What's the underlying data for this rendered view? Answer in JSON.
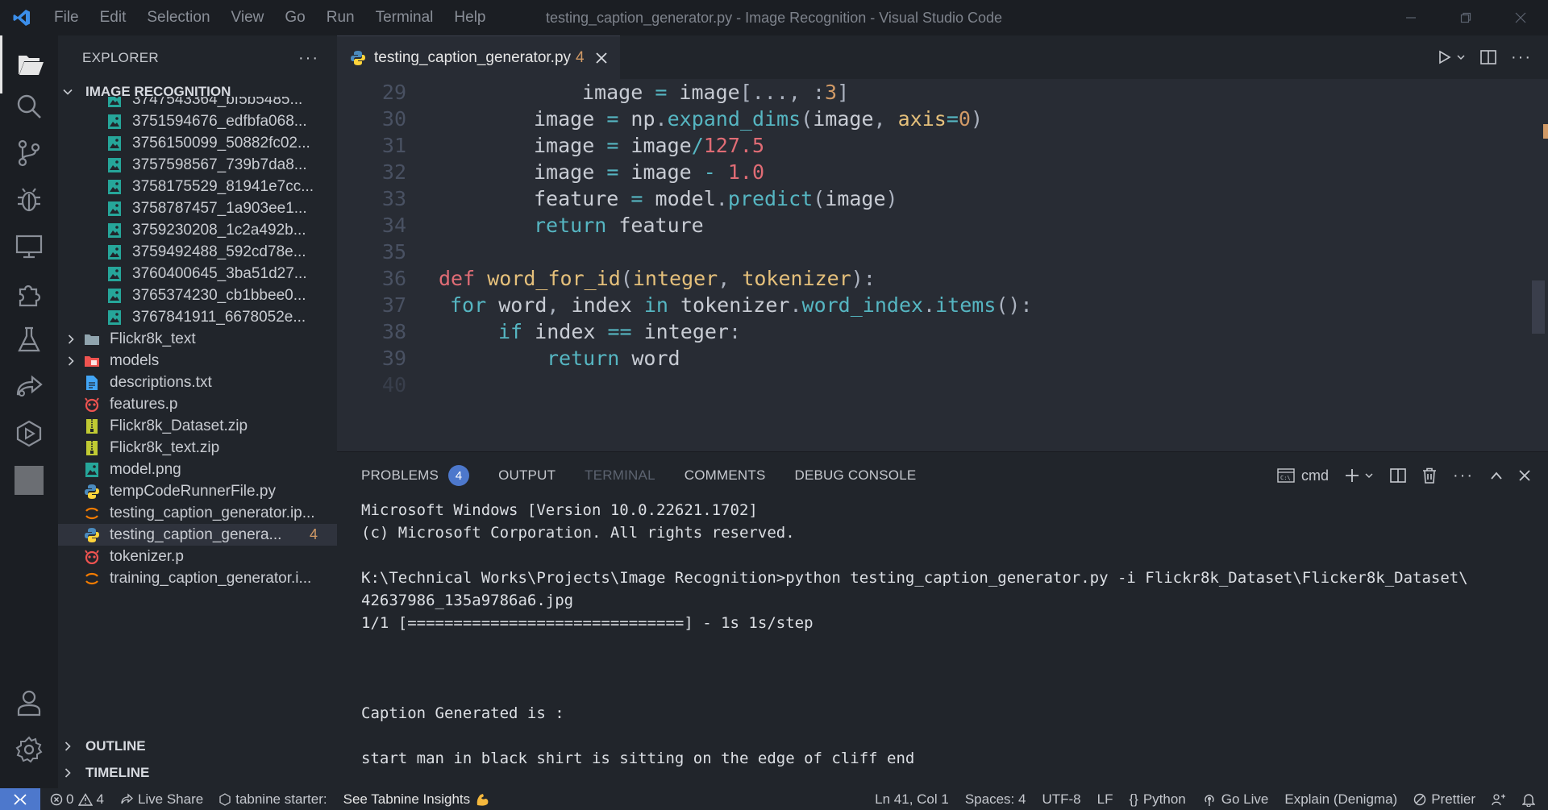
{
  "window": {
    "title": "testing_caption_generator.py - Image Recognition - Visual Studio Code",
    "menu": [
      "File",
      "Edit",
      "Selection",
      "View",
      "Go",
      "Run",
      "Terminal",
      "Help"
    ]
  },
  "sidebar": {
    "header": "EXPLORER",
    "project": "IMAGE RECOGNITION",
    "items": [
      {
        "name": "3747543364_bf5b5485...",
        "icon": "image-icon",
        "indent": 2
      },
      {
        "name": "3751594676_edfbfa068...",
        "icon": "image-icon",
        "indent": 2
      },
      {
        "name": "3756150099_50882fc02...",
        "icon": "image-icon",
        "indent": 2
      },
      {
        "name": "3757598567_739b7da8...",
        "icon": "image-icon",
        "indent": 2
      },
      {
        "name": "3758175529_81941e7cc...",
        "icon": "image-icon",
        "indent": 2
      },
      {
        "name": "3758787457_1a903ee1...",
        "icon": "image-icon",
        "indent": 2
      },
      {
        "name": "3759230208_1c2a492b...",
        "icon": "image-icon",
        "indent": 2
      },
      {
        "name": "3759492488_592cd78e...",
        "icon": "image-icon",
        "indent": 2
      },
      {
        "name": "3760400645_3ba51d27...",
        "icon": "image-icon",
        "indent": 2
      },
      {
        "name": "3765374230_cb1bbee0...",
        "icon": "image-icon",
        "indent": 2
      },
      {
        "name": "3767841911_6678052e...",
        "icon": "image-icon",
        "indent": 2
      },
      {
        "name": "Flickr8k_text",
        "icon": "folder-icon",
        "indent": 1,
        "folder": true
      },
      {
        "name": "models",
        "icon": "folder-models-icon",
        "indent": 1,
        "folder": true
      },
      {
        "name": "descriptions.txt",
        "icon": "text-file-icon",
        "indent": 1
      },
      {
        "name": "features.p",
        "icon": "pickle-file-icon",
        "indent": 1
      },
      {
        "name": "Flickr8k_Dataset.zip",
        "icon": "zip-file-icon",
        "indent": 1
      },
      {
        "name": "Flickr8k_text.zip",
        "icon": "zip-file-icon",
        "indent": 1
      },
      {
        "name": "model.png",
        "icon": "image-icon",
        "indent": 1
      },
      {
        "name": "tempCodeRunnerFile.py",
        "icon": "python-icon",
        "indent": 1
      },
      {
        "name": "testing_caption_generator.ip...",
        "icon": "jupyter-icon",
        "indent": 1
      },
      {
        "name": "testing_caption_genera...",
        "icon": "python-icon",
        "indent": 1,
        "selected": true,
        "badge": "4"
      },
      {
        "name": "tokenizer.p",
        "icon": "pickle-file-icon",
        "indent": 1
      },
      {
        "name": "training_caption_generator.i...",
        "icon": "jupyter-icon",
        "indent": 1
      }
    ],
    "outline": "OUTLINE",
    "timeline": "TIMELINE"
  },
  "editor": {
    "tab": {
      "label": "testing_caption_generator.py",
      "problems": "4"
    },
    "lines": [
      {
        "n": "29"
      },
      {
        "n": "30"
      },
      {
        "n": "31"
      },
      {
        "n": "32"
      },
      {
        "n": "33"
      },
      {
        "n": "34"
      },
      {
        "n": "35"
      },
      {
        "n": "36"
      },
      {
        "n": "37"
      },
      {
        "n": "38"
      },
      {
        "n": "39"
      },
      {
        "n": "40"
      }
    ]
  },
  "panel": {
    "tabs": [
      "PROBLEMS",
      "OUTPUT",
      "TERMINAL",
      "COMMENTS",
      "DEBUG CONSOLE"
    ],
    "problems_count": "4",
    "shell": "cmd",
    "terminal_lines": [
      "Microsoft Windows [Version 10.0.22621.1702]",
      "(c) Microsoft Corporation. All rights reserved.",
      "",
      "K:\\Technical Works\\Projects\\Image Recognition>python testing_caption_generator.py -i Flickr8k_Dataset\\Flicker8k_Dataset\\",
      "42637986_135a9786a6.jpg",
      "1/1 [==============================] - 1s 1s/step",
      "",
      "",
      "",
      "Caption Generated is :",
      "",
      "start man in black shirt is sitting on the edge of cliff end"
    ]
  },
  "status": {
    "errors": "0",
    "warnings": "4",
    "live_share": "Live Share",
    "tabnine": "tabnine starter:",
    "tabnine_insights": "See Tabnine Insights",
    "position": "Ln 41, Col 1",
    "spaces": "Spaces: 4",
    "encoding": "UTF-8",
    "eol": "LF",
    "language": "Python",
    "go_live": "Go Live",
    "explain": "Explain (Denigma)",
    "prettier": "Prettier"
  },
  "colors": {
    "accent": "#4d78cc",
    "warning": "#d19a66"
  }
}
